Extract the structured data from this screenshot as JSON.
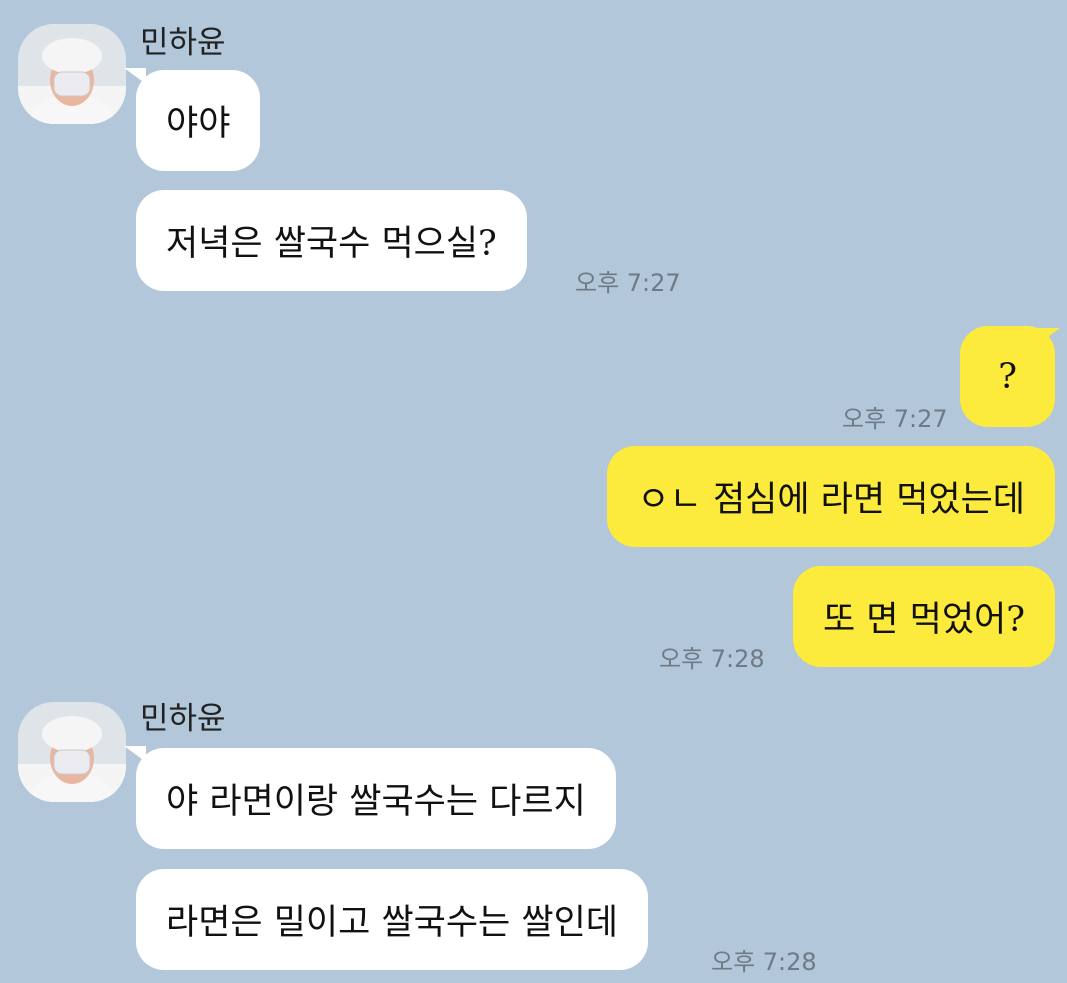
{
  "groups": [
    {
      "sender": "민하윤",
      "messages": [
        {
          "text": "야야"
        },
        {
          "text": "저녁은 쌀국수 먹으실?",
          "time": "오후 7:27"
        }
      ]
    },
    {
      "sender": "me",
      "messages": [
        {
          "text": "?",
          "time": "오후 7:27"
        },
        {
          "text": "ㅇㄴ 점심에 라면 먹었는데"
        },
        {
          "text": "또 면 먹었어?",
          "time": "오후 7:28"
        }
      ]
    },
    {
      "sender": "민하윤",
      "messages": [
        {
          "text": "야 라면이랑 쌀국수는 다르지"
        },
        {
          "text": "라면은 밀이고 쌀국수는 쌀인데",
          "time": "오후 7:28"
        }
      ]
    }
  ],
  "icons": {
    "avatar": "user-photo-icon"
  },
  "colors": {
    "background": "#b2c7da",
    "incoming_bubble": "#ffffff",
    "outgoing_bubble": "#fcea3c",
    "timestamp": "#6e7a85"
  }
}
